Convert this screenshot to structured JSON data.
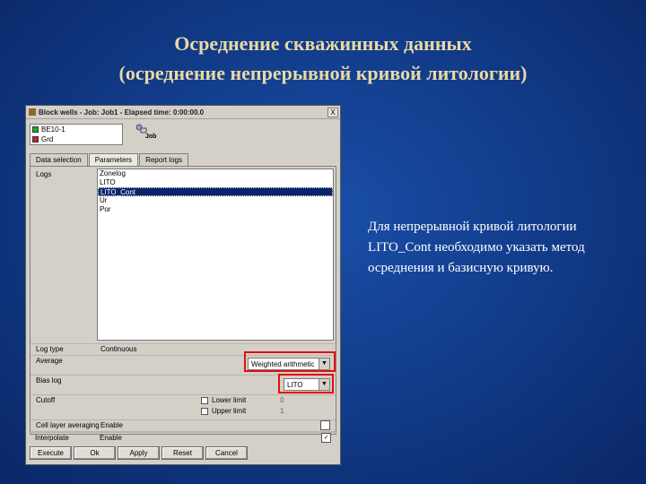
{
  "slide": {
    "title_line1": "Осреднение скважинных данных",
    "title_line2": "(осреднение непрерывной кривой литологии)",
    "description": "Для непрерывной кривой литологии LITO_Cont необходимо указать метод осреднения и базисную кривую."
  },
  "window": {
    "title": "Block wells - Job: Job1 - Elapsed time: 0:00:00.0",
    "close_label": "X",
    "wells": [
      {
        "name": "BE10-1",
        "color": "#22aa22"
      },
      {
        "name": "Grd",
        "color": "#cc2222"
      }
    ],
    "job_label": "Job",
    "tabs": [
      "Data selection",
      "Parameters",
      "Report logs"
    ],
    "active_tab": 1,
    "logs_label": "Logs",
    "logs": [
      "Zonelog",
      "LITO",
      "LITO_Cont",
      "Ur",
      "Por"
    ],
    "selected_log": 2,
    "params": {
      "log_type_label": "Log type",
      "log_type_value": "Continuous",
      "average_label": "Average",
      "average_value": "Weighted arithmetic",
      "bias_label": "Bias log",
      "bias_value": "LITO",
      "cutoff_label": "Cutoff",
      "lower_limit_label": "Lower limit",
      "lower_limit_value": "0",
      "upper_limit_label": "Upper limit",
      "upper_limit_value": "1",
      "cell_layer_label": "Cell layer averaging",
      "cell_layer_value": "Enable",
      "interpolate_label": "Interpolate",
      "interpolate_value": "Enable"
    },
    "buttons": [
      "Execute",
      "Ok",
      "Apply",
      "Reset",
      "Cancel"
    ],
    "accent_red": "#e01010",
    "selection_blue": "#0a246a"
  }
}
